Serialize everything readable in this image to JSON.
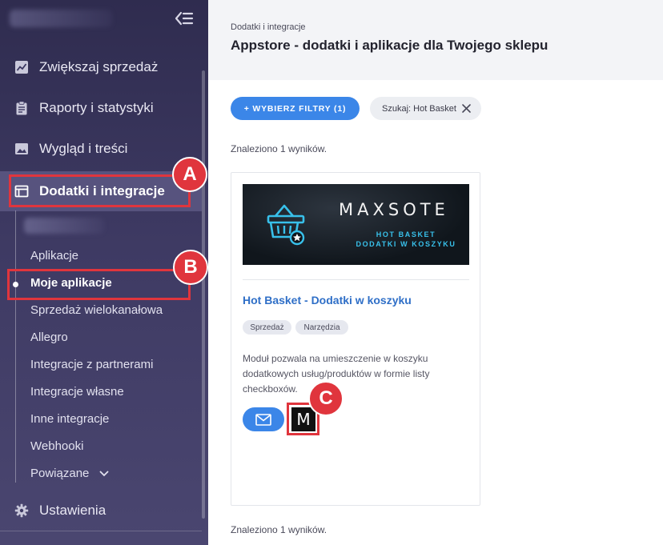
{
  "sidebar": {
    "nav": [
      {
        "label": "Zwiększaj sprzedaż",
        "icon": "chart-line-icon"
      },
      {
        "label": "Raporty i statystyki",
        "icon": "clipboard-icon"
      },
      {
        "label": "Wygląd i treści",
        "icon": "image-icon"
      },
      {
        "label": "Dodatki i integracje",
        "icon": "window-icon"
      }
    ],
    "subitems": [
      "Aplikacje",
      "Moje aplikacje",
      "Sprzedaż wielokanałowa",
      "Allegro",
      "Integracje z partnerami",
      "Integracje własne",
      "Inne integracje",
      "Webhooki",
      "Powiązane"
    ],
    "settings": {
      "label": "Ustawienia",
      "icon": "gear-icon"
    }
  },
  "header": {
    "breadcrumb": "Dodatki i integracje",
    "title": "Appstore - dodatki i aplikacje dla Twojego sklepu"
  },
  "filters": {
    "button_label": "+ WYBIERZ FILTRY (1)",
    "search_chip": "Szukaj: Hot Basket"
  },
  "results": {
    "count_text": "Znaleziono 1 wyników."
  },
  "card": {
    "banner": {
      "brand": "MAXSOTE",
      "line1": "HOT BASKET",
      "line2": "DODATKI W KOSZYKU"
    },
    "name": "Hot Basket - Dodatki w koszyku",
    "tags": [
      "Sprzedaż",
      "Narzędzia"
    ],
    "description": "Moduł pozwala na umieszczenie w koszyku dodatkowych usług/produktów w formie listy checkboxów.",
    "vendor_logo_letter": "M"
  },
  "annotations": [
    "A",
    "B",
    "C"
  ],
  "colors": {
    "accent": "#3b86e8",
    "annotation": "#e0353d",
    "link": "#2f6fc7",
    "banner_cyan": "#38c0ea"
  }
}
